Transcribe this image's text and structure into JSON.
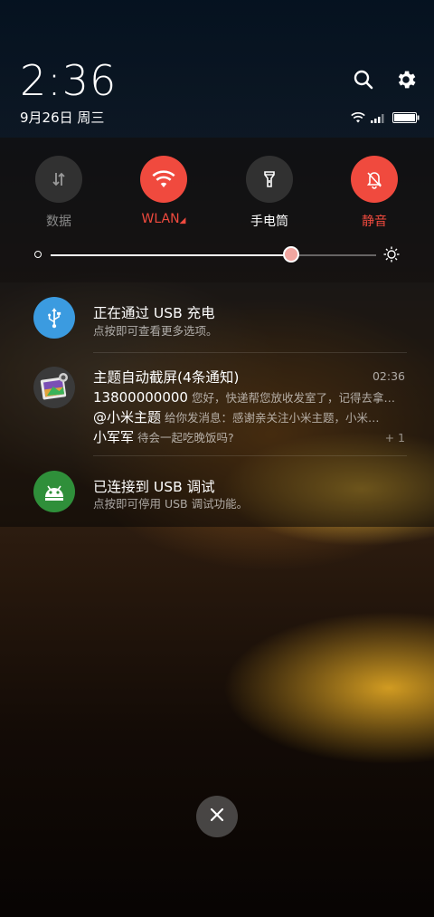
{
  "header": {
    "time": "2:36",
    "date": "9月26日 周三"
  },
  "icons": {
    "search": "search-icon",
    "settings": "gear-icon",
    "wifi": "wifi-icon",
    "signal": "signal-icon",
    "battery": "battery-icon"
  },
  "quick_settings": {
    "tiles": [
      {
        "label": "数据",
        "state": "off",
        "icon": "mobile-data-icon"
      },
      {
        "label": "WLAN",
        "state": "on",
        "icon": "wifi-icon"
      },
      {
        "label": "手电筒",
        "state": "off",
        "icon": "flashlight-icon"
      },
      {
        "label": "静音",
        "state": "on",
        "icon": "mute-icon"
      }
    ],
    "accent": "#f04a3e",
    "brightness_level": 0.74
  },
  "notifications": [
    {
      "title": "正在通过 USB 充电",
      "subtitle": "点按即可查看更多选项。",
      "icon": "usb-icon",
      "icon_color": "#3b9be0"
    },
    {
      "title": "主题自动截屏(4条通知)",
      "time": "02:36",
      "icon": "screenshot-gallery-icon",
      "messages": [
        {
          "sender": "13800000000",
          "text": "您好，快递帮您放收发室了，记得去拿…"
        },
        {
          "sender": "@小米主题",
          "text": "给你发消息：感谢亲关注小米主题，小米…"
        },
        {
          "sender": "小军军",
          "text": "待会一起吃晚饭吗?"
        }
      ],
      "more": "+ 1"
    },
    {
      "title": "已连接到 USB 调试",
      "subtitle": "点按即可停用 USB 调试功能。",
      "icon": "android-icon",
      "icon_color": "#2f8f3a"
    }
  ],
  "close_button": {
    "icon": "close-icon"
  }
}
